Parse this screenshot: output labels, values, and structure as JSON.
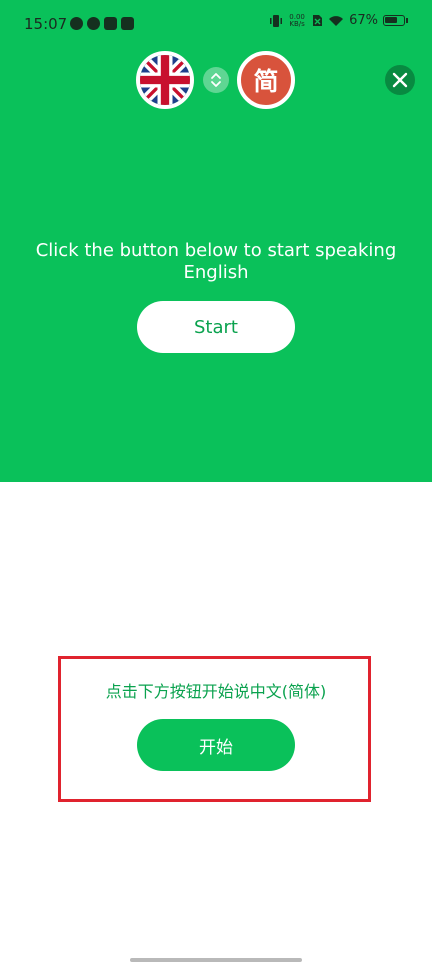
{
  "status_bar": {
    "time": "15:07",
    "net_speed_value": "0.00",
    "net_speed_unit": "KB/s",
    "battery": "67%"
  },
  "language_bar": {
    "source_language_icon": "uk-flag-icon",
    "target_language_label": "简",
    "swap_icon": "swap-icon",
    "close_icon": "close-icon"
  },
  "source_panel": {
    "prompt": "Click the button below to start speaking English",
    "start_button": "Start"
  },
  "target_panel": {
    "prompt": "点击下方按钮开始说中文(简体)",
    "start_button": "开始"
  },
  "colors": {
    "accent": "#0ac15a",
    "highlight_border": "#e0232e",
    "target_flag": "#d8533c"
  }
}
